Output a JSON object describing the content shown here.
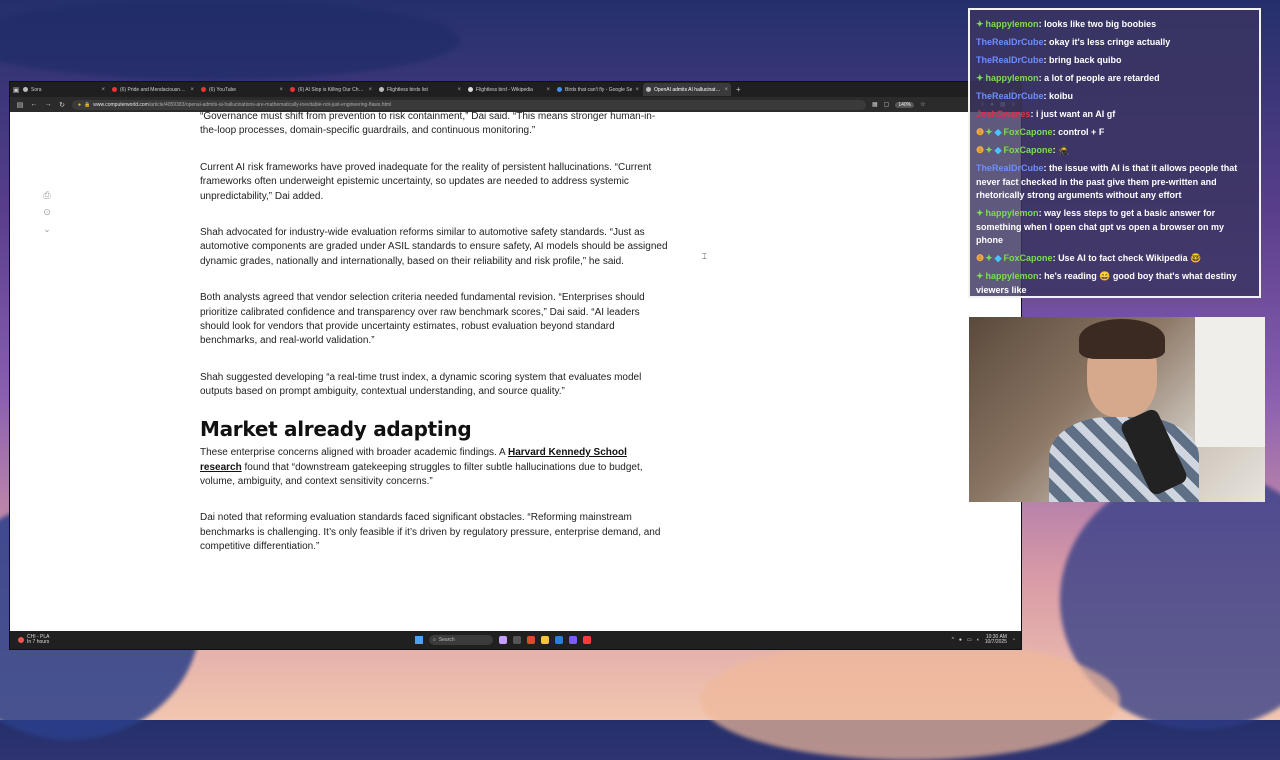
{
  "browser": {
    "tabs": [
      {
        "label": "Sora",
        "icon": "sora-icon"
      },
      {
        "label": "(6) Pride and Mendaciousness",
        "icon": "youtube-icon"
      },
      {
        "label": "(6) YouTube",
        "icon": "youtube-icon"
      },
      {
        "label": "(6) AI Slop is Killing Our Chann",
        "icon": "youtube-icon"
      },
      {
        "label": "Flightless birds list",
        "icon": "web-icon"
      },
      {
        "label": "Flightless bird - Wikipedia",
        "icon": "wikipedia-icon"
      },
      {
        "label": "Birds that can't fly - Google Se",
        "icon": "google-icon"
      },
      {
        "label": "OpenAI admits AI hallucination",
        "icon": "web-icon"
      }
    ],
    "active_tab": 7,
    "url_host": "www.computerworld.com",
    "url_path": "/article/4059383/openai-admits-ai-hallucinations-are-mathematically-inevitable-not-just-engineering-flaws.html",
    "zoom": "140%"
  },
  "article": {
    "paragraphs_top": [
      "“Governance must shift from prevention to risk containment,” Dai said. “This means stronger human-in-the-loop processes, domain-specific guardrails, and continuous monitoring.”",
      "Current AI risk frameworks have proved inadequate for the reality of persistent hallucinations. “Current frameworks often underweight epistemic uncertainty, so updates are needed to address systemic unpredictability,” Dai added.",
      "Shah advocated for industry-wide evaluation reforms similar to automotive safety standards. “Just as automotive components are graded under ASIL standards to ensure safety, AI models should be assigned dynamic grades, nationally and internationally, based on their reliability and risk profile,” he said.",
      "Both analysts agreed that vendor selection criteria needed fundamental revision. “Enterprises should prioritize calibrated confidence and transparency over raw benchmark scores,” Dai said. “AI leaders should look for vendors that provide uncertainty estimates, robust evaluation beyond standard benchmarks, and real-world validation.”",
      "Shah suggested developing “a real-time trust index, a dynamic scoring system that evaluates model outputs based on prompt ambiguity, contextual understanding, and source quality.”"
    ],
    "heading": "Market already adapting",
    "p6_before": "These enterprise concerns aligned with broader academic findings. A ",
    "p6_link": "Harvard Kennedy School research",
    "p6_after": " found that “downstream gatekeeping struggles to filter subtle hallucinations due to budget, volume, ambiguity, and context sensitivity concerns.”",
    "p7": "Dai noted that reforming evaluation standards faced significant obstacles. “Reforming mainstream benchmarks is challenging. It’s only feasible if it’s driven by regulatory pressure, enterprise demand, and competitive differentiation.”"
  },
  "taskbar": {
    "weather_line1": "CHI - PLA",
    "weather_line2": "In 7 hours",
    "search_label": "Search",
    "time": "10:30 AM",
    "date": "10/7/2025"
  },
  "chat": {
    "messages": [
      {
        "user": "happylemon",
        "color": "#7ddc52",
        "badges": [
          "sub"
        ],
        "text": "looks like two big boobies"
      },
      {
        "user": "TheRealDrCube",
        "color": "#6b8fff",
        "badges": [],
        "text": "okay it's less cringe actually"
      },
      {
        "user": "TheRealDrCube",
        "color": "#6b8fff",
        "badges": [],
        "text": "bring back quibo"
      },
      {
        "user": "happylemon",
        "color": "#7ddc52",
        "badges": [
          "sub"
        ],
        "text": "a lot of people are retarded"
      },
      {
        "user": "TheRealDrCube",
        "color": "#6b8fff",
        "badges": [],
        "text": "koibu"
      },
      {
        "user": "JoshSwanes",
        "color": "#e0304a",
        "badges": [],
        "text": "i just want an AI gf"
      },
      {
        "user": "FoxCapone",
        "color": "#7ddc52",
        "badges": [
          "gift",
          "sub",
          "diamond"
        ],
        "text": "control + F"
      },
      {
        "user": "FoxCapone",
        "color": "#7ddc52",
        "badges": [
          "gift",
          "sub",
          "diamond"
        ],
        "text": "🥷"
      },
      {
        "user": "TheRealDrCube",
        "color": "#6b8fff",
        "badges": [],
        "text": "the issue with AI is that it allows people that never fact checked in the past give them pre-written and rhetorically strong arguments without any effort"
      },
      {
        "user": "happylemon",
        "color": "#7ddc52",
        "badges": [
          "sub"
        ],
        "text": "way less steps to get a basic answer for something when I open chat gpt vs open a browser on my phone"
      },
      {
        "user": "FoxCapone",
        "color": "#7ddc52",
        "badges": [
          "gift",
          "sub",
          "diamond"
        ],
        "text": "Use AI to fact check Wikipedia 🤓"
      },
      {
        "user": "happylemon",
        "color": "#7ddc52",
        "badges": [
          "sub"
        ],
        "text": "he's reading 😄 good boy that's what destiny viewers like"
      }
    ]
  }
}
